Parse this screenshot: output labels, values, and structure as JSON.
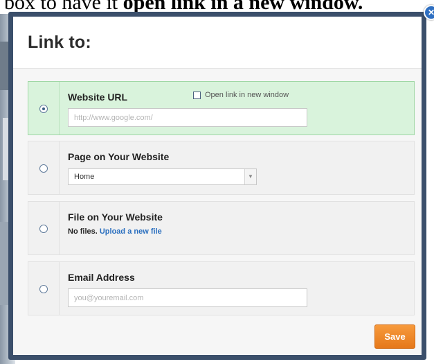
{
  "background": {
    "text_plain": "box to have it ",
    "text_bold": "open link in a new window."
  },
  "dialog": {
    "title": "Link to:",
    "close_glyph": "✕",
    "options": {
      "website_url": {
        "label": "Website URL",
        "selected": true,
        "placeholder": "http://www.google.com/",
        "new_window_label": "Open link in new window"
      },
      "page": {
        "label": "Page on Your Website",
        "selected": false,
        "select_value": "Home"
      },
      "file": {
        "label": "File on Your Website",
        "selected": false,
        "no_files_text": "No files.",
        "upload_link": "Upload a new file"
      },
      "email": {
        "label": "Email Address",
        "selected": false,
        "placeholder": "you@youremail.com"
      }
    },
    "save_label": "Save"
  },
  "colors": {
    "dialog_border": "#3b4f6b",
    "selected_panel": "#d9f3dc",
    "link": "#2a6fbf",
    "save_button": "#f28a2e"
  }
}
